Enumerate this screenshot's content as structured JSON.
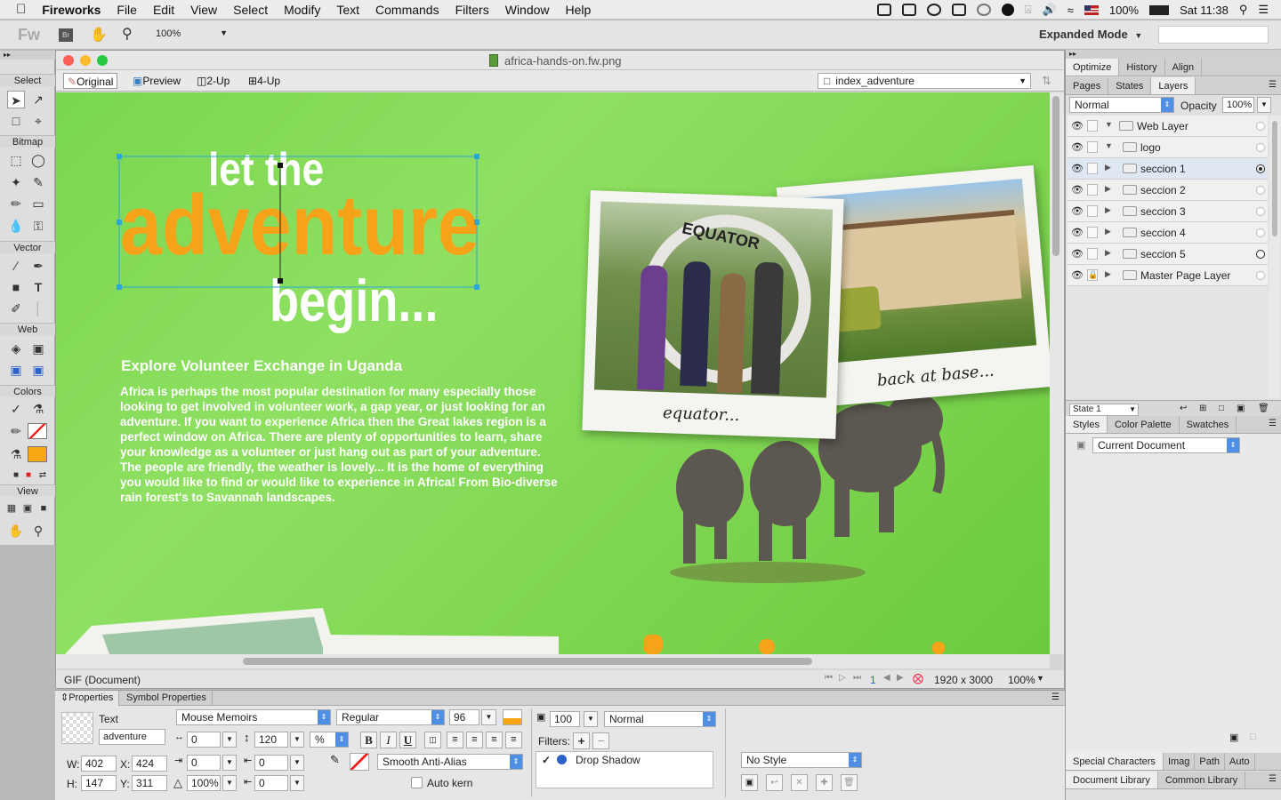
{
  "menubar": {
    "app": "Fireworks",
    "items": [
      "File",
      "Edit",
      "View",
      "Select",
      "Modify",
      "Text",
      "Commands",
      "Filters",
      "Window",
      "Help"
    ],
    "battery": "100%",
    "clock": "Sat 11:38"
  },
  "appbar": {
    "logo": "Fw",
    "bridge": "Br",
    "zoom": "100%",
    "mode": "Expanded Mode"
  },
  "tools": {
    "sections": [
      "Select",
      "Bitmap",
      "Vector",
      "Web",
      "Colors",
      "View"
    ]
  },
  "document": {
    "title": "africa-hands-on.fw.png",
    "tabs": [
      "Original",
      "Preview",
      "2-Up",
      "4-Up"
    ],
    "page_select": "index_adventure",
    "status_format": "GIF (Document)",
    "frame": "1",
    "dimensions": "1920 x 3000",
    "zoom": "100%"
  },
  "canvas": {
    "headline_1": "let the",
    "headline_2": "adventure",
    "headline_3": "begin...",
    "subtitle": "Explore Volunteer Exchange in Uganda",
    "body": "Africa is perhaps the most popular destination for many especially those looking to get involved in volunteer work, a gap year, or just looking for an adventure.  If you want to experience Africa then the Great lakes region is a perfect window on Africa. There are plenty of opportunities to learn, share your knowledge as a  volunteer or just hang out as part of your adventure. The people are friendly, the weather is lovely... It is the home of everything you would like to find or would like to experience in Africa!  From Bio-diverse  rain forest's to Savannah landscapes.",
    "photo1_caption": "equator...",
    "photo1_sign": "EQUATOR",
    "photo2_caption": "back at base..."
  },
  "right_panel": {
    "top_tabs": [
      "Optimize",
      "History",
      "Align"
    ],
    "layer_tabs": [
      "Pages",
      "States",
      "Layers"
    ],
    "blend": "Normal",
    "opacity_label": "Opacity",
    "opacity": "100%",
    "layers": [
      {
        "name": "Web Layer",
        "expanded": true,
        "locked": false
      },
      {
        "name": "logo",
        "expanded": true,
        "locked": false
      },
      {
        "name": "seccion 1",
        "expanded": false,
        "locked": false
      },
      {
        "name": "seccion 2",
        "expanded": false,
        "locked": false
      },
      {
        "name": "seccion 3",
        "expanded": false,
        "locked": false
      },
      {
        "name": "seccion 4",
        "expanded": false,
        "locked": false
      },
      {
        "name": "seccion 5",
        "expanded": false,
        "locked": false
      },
      {
        "name": "Master Page Layer",
        "expanded": false,
        "locked": true
      }
    ],
    "state": "State 1",
    "style_tabs": [
      "Styles",
      "Color Palette",
      "Swatches"
    ],
    "styles_source": "Current Document",
    "bottom_tabs_1": [
      "Special Characters",
      "Imag",
      "Path",
      "Auto"
    ],
    "bottom_tabs_2": [
      "Document Library",
      "Common Library"
    ]
  },
  "properties": {
    "tabs": [
      "Properties",
      "Symbol Properties"
    ],
    "object_type": "Text",
    "object_name": "adventure",
    "w_label": "W:",
    "w": "402",
    "x_label": "X:",
    "x": "424",
    "h_label": "H:",
    "h": "147",
    "y_label": "Y:",
    "y": "311",
    "font": "Mouse Memoirs",
    "style": "Regular",
    "size": "96",
    "kerning": "0",
    "leading": "120",
    "leading_unit": "%",
    "indent": "0",
    "space_before": "0",
    "space_after": "0",
    "baseline": "0",
    "horiz_scale": "100%",
    "anti_alias": "Smooth Anti-Alias",
    "auto_kern": "Auto kern",
    "opacity": "100",
    "blend": "Normal",
    "filters_label": "Filters:",
    "filter": "Drop Shadow",
    "style_select": "No Style"
  }
}
